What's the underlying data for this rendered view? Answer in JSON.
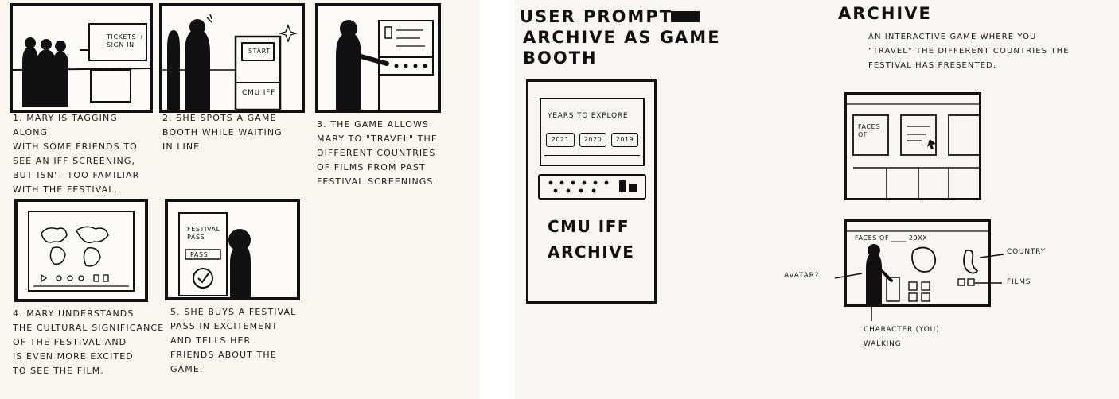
{
  "storyboard": {
    "captions": [
      "1. Mary is tagging along\nwith some friends to\nsee an IFF screening,\nbut isn't too familiar\nwith the festival.",
      "2. She spots a game\nbooth while waiting\nin line.",
      "3. The game allows\nMary to \"travel\" the\ndifferent countries\nof films from past\nfestival screenings.",
      "4. Mary understands\nthe cultural significance\nof the festival and\nis even more excited\nto see the film.",
      "5. She buys a festival\npass in excitement\nand tells her\nfriends about the\ngame."
    ],
    "panel1": {
      "sign": "Tickets +\nsign in"
    },
    "panel2": {
      "screen": "Start",
      "booth": "CMU IFF"
    },
    "panel5": {
      "pass_title": "Festival\npass",
      "pass_button": "Pass"
    }
  },
  "prompt": {
    "heading": "User prompt:",
    "subtitle": "Archive as game\nbooth",
    "screen_title": "Years to explore",
    "years": [
      "2021",
      "2020",
      "2019"
    ],
    "booth_name": "CMU IFF\nArchive"
  },
  "archive": {
    "title": "Archive",
    "description": "An interactive game where you\n\"travel\" the different countries the\nfestival has presented.",
    "tile_label": "Faces\nof",
    "game_header": "Faces of ____ 20XX",
    "annotations": {
      "avatar": "Avatar?",
      "country": "Country",
      "films": "Films",
      "character": "Character (you)\nwalking"
    }
  }
}
